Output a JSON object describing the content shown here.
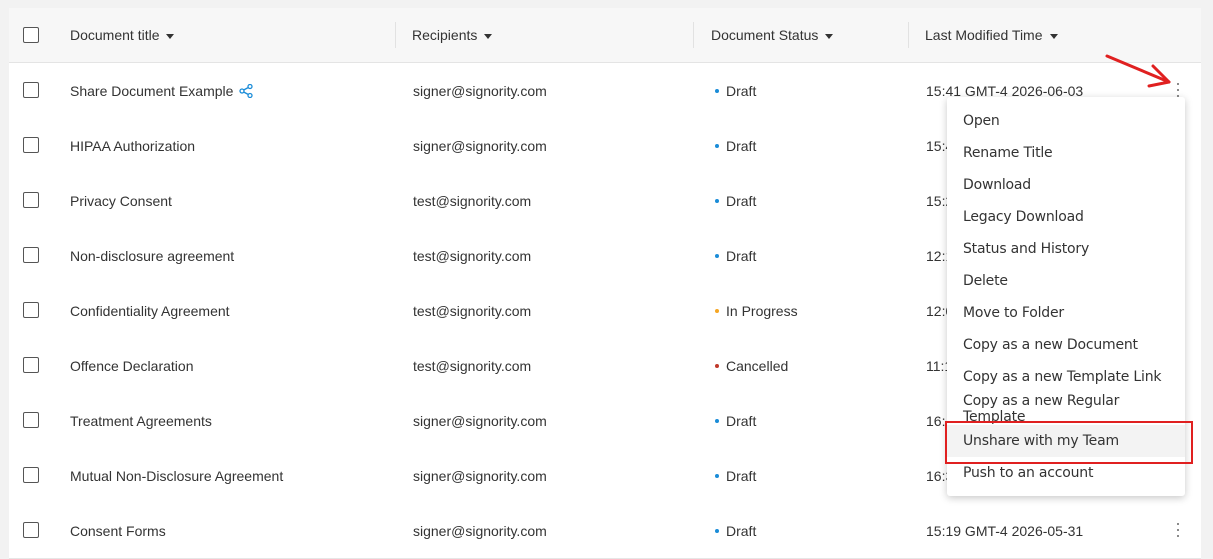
{
  "columns": {
    "title": "Document title",
    "recipients": "Recipients",
    "status": "Document Status",
    "modified": "Last Modified Time"
  },
  "colors": {
    "draft": "#1a8cd8",
    "in_progress": "#f5a623",
    "cancelled": "#c0392b",
    "highlight": "#e02020"
  },
  "rows": [
    {
      "title": "Share Document Example",
      "recipient": "signer@signority.com",
      "status": "Draft",
      "modified": "15:41 GMT-4 2026-06-03",
      "shared": true
    },
    {
      "title": "HIPAA Authorization",
      "recipient": "signer@signority.com",
      "status": "Draft",
      "modified": "15:4"
    },
    {
      "title": "Privacy Consent",
      "recipient": "test@signority.com",
      "status": "Draft",
      "modified": "15:2"
    },
    {
      "title": "Non-disclosure agreement",
      "recipient": "test@signority.com",
      "status": "Draft",
      "modified": "12:1"
    },
    {
      "title": "Confidentiality Agreement",
      "recipient": "test@signority.com",
      "status": "In Progress",
      "modified": "12:0"
    },
    {
      "title": "Offence Declaration",
      "recipient": "test@signority.com",
      "status": "Cancelled",
      "modified": "11:1"
    },
    {
      "title": "Treatment Agreements",
      "recipient": "signer@signority.com",
      "status": "Draft",
      "modified": "16:"
    },
    {
      "title": "Mutual Non-Disclosure Agreement",
      "recipient": "signer@signority.com",
      "status": "Draft",
      "modified": "16:3"
    },
    {
      "title": "Consent Forms",
      "recipient": "signer@signority.com",
      "status": "Draft",
      "modified": "15:19 GMT-4 2026-05-31"
    }
  ],
  "menu": {
    "items": [
      "Open",
      "Rename Title",
      "Download",
      "Legacy Download",
      "Status and History",
      "Delete",
      "Move to Folder",
      "Copy as a new Document",
      "Copy as a new Template Link",
      "Copy as a new Regular Template",
      "Unshare with my Team",
      "Push to an account"
    ],
    "highlighted": "Unshare with my Team"
  }
}
